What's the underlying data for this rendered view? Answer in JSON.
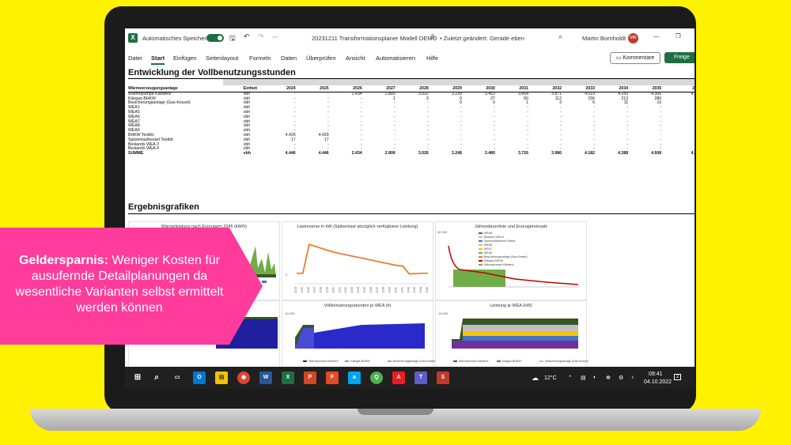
{
  "window": {
    "app_icon": "excel-icon",
    "autosave_label": "Automatisches Speichern",
    "filename": "20231211 Transformationsplaner Modell DEMO",
    "saved_status": "• Zuletzt geändert: Gerade eben",
    "user_name": "Martin Bornholdt",
    "user_initials": "MB"
  },
  "menu": [
    "Datei",
    "Start",
    "Einfügen",
    "Seitenlayout",
    "Formeln",
    "Daten",
    "Überprüfen",
    "Ansicht",
    "Automatisieren",
    "Hilfe"
  ],
  "menu_active": "Start",
  "comment_button": "Kommentare",
  "share_button": "Freige",
  "sheet": {
    "section1_title": "Entwicklung der Vollbenutzungsstunden",
    "section2_title": "Ergebnisgrafiken",
    "table": {
      "headers": [
        "Wärmeerzeugungsanlage",
        "Einheit",
        "2024",
        "2025",
        "2026",
        "2027",
        "2028",
        "2029",
        "2030",
        "2031",
        "2032",
        "2033",
        "2034",
        "2035",
        "2"
      ],
      "rows": [
        [
          "Wärmepumpe Klärwerk",
          "vbh",
          "-",
          "-",
          "2.434",
          "2.805",
          "3.022",
          "3.239",
          "3.453",
          "3.664",
          "3.871",
          "4.019",
          "4.165",
          "4.306",
          "4."
        ],
        [
          "Klärgas-BHKW",
          "vbh",
          "-",
          "-",
          "-",
          "1",
          "3",
          "9",
          "27",
          "60",
          "112",
          "156",
          "213",
          "286",
          ""
        ],
        [
          "Besicherungsanlage (Gas-Kessel)",
          "vbh",
          "-",
          "-",
          "-",
          "-",
          "-",
          "0",
          "0",
          "1",
          "3",
          "6",
          "11",
          "16",
          ""
        ],
        [
          "WEA1",
          "vbh",
          "-",
          "-",
          "-",
          "-",
          "-",
          "-",
          "-",
          "-",
          "-",
          "-",
          "-",
          "-",
          ""
        ],
        [
          "WEA5",
          "vbh",
          "-",
          "-",
          "-",
          "-",
          "-",
          "-",
          "-",
          "-",
          "-",
          "-",
          "-",
          "-",
          ""
        ],
        [
          "WEA6",
          "vbh",
          "-",
          "-",
          "-",
          "-",
          "-",
          "-",
          "-",
          "-",
          "-",
          "-",
          "-",
          "-",
          ""
        ],
        [
          "WEA7",
          "vbh",
          "-",
          "-",
          "-",
          "-",
          "-",
          "-",
          "-",
          "-",
          "-",
          "-",
          "-",
          "-",
          ""
        ],
        [
          "WEA8",
          "vbh",
          "-",
          "-",
          "-",
          "-",
          "-",
          "-",
          "-",
          "-",
          "-",
          "-",
          "-",
          "-",
          ""
        ],
        [
          "WEA9",
          "vbh",
          "-",
          "-",
          "-",
          "-",
          "-",
          "-",
          "-",
          "-",
          "-",
          "-",
          "-",
          "-",
          ""
        ],
        [
          "BHKW Testbtr.",
          "vbh",
          "4.429",
          "4.429",
          "-",
          "-",
          "-",
          "-",
          "-",
          "-",
          "-",
          "-",
          "-",
          "-",
          ""
        ],
        [
          "Spitzenlastkessel Testbtr.",
          "vbh",
          "17",
          "17",
          "-",
          "-",
          "-",
          "-",
          "-",
          "-",
          "-",
          "-",
          "-",
          "-",
          ""
        ],
        [
          "Bestands WEA 3",
          "vbh",
          "-",
          "-",
          "-",
          "-",
          "-",
          "-",
          "-",
          "-",
          "-",
          "-",
          "-",
          "-",
          ""
        ],
        [
          "Bestands WEA 4",
          "vbh",
          "-",
          "-",
          "-",
          "-",
          "-",
          "-",
          "-",
          "-",
          "-",
          "-",
          "-",
          "-",
          ""
        ]
      ],
      "sum_row": [
        "SUMME",
        "vbh",
        "4.446",
        "4.446",
        "2.434",
        "2.806",
        "3.026",
        "3.248",
        "3.480",
        "3.726",
        "3.986",
        "4.182",
        "4.388",
        "4.608",
        "4."
      ]
    },
    "charts": {
      "c1": {
        "title": "Wärmeleistung nach Erzeugern 2045 (kW/h)",
        "ytick": "1.200"
      },
      "c2": {
        "title": "Lastreserve in kW (Spitzenlast abzüglich verfügbarer Leistung)",
        "ytick": "0",
        "x": [
          "2024",
          "2025",
          "2026",
          "2027",
          "2028",
          "2029",
          "2030",
          "2031",
          "2032",
          "2033",
          "2034",
          "2035",
          "2036",
          "2037",
          "2038",
          "2039",
          "2040",
          "2041",
          "2042",
          "2043",
          "2044",
          "2045"
        ],
        "values": [
          1600,
          1600,
          6000,
          5700,
          5400,
          5100,
          4800,
          4600,
          4400,
          4200,
          4000,
          3800,
          3600,
          3400,
          3200,
          3000,
          2800,
          2700,
          1500,
          1550,
          1600,
          1600
        ]
      },
      "c3": {
        "title": "Jahresdauerlinie und Erzeugereinsatz",
        "ytick": "40.000",
        "legend": [
          "WEA8",
          "Bestand WEA 4",
          "Spitzenlastkessel Testbtr.",
          "WEA8",
          "WEA7",
          "WEA5",
          "Besicherungsanlage (Gas-Kessel)",
          "Klärgas-BHKW",
          "Wärmepumpe Klärwerk"
        ],
        "colors": [
          "#7f6000",
          "#bfbfbf",
          "#4472c4",
          "#a9d18e",
          "#ffc000",
          "#70ad47",
          "#ed7d31",
          "#c00000",
          "#70ad47"
        ]
      },
      "c5": {
        "title": "Vollbenutzungsstunden je WEA (h)",
        "ytick": "10.000",
        "legend": [
          "Wärmepumpe Klärwerk",
          "Klärgas-BHKW",
          "Besicherungsanlage (Gas-Kessel)",
          "WEA4",
          "WEA5",
          "WEA6",
          "WEA7",
          "WEA8"
        ]
      },
      "c6": {
        "title": "Leistung je WEA (kW)",
        "ytick": "10.000",
        "legend": [
          "Wärmepumpe Klärwerk",
          "Klärgas-BHKW",
          "Besicherungsanlage (Gas-Kessel)",
          "WEA4",
          "WEA5",
          "WEA6"
        ]
      }
    }
  },
  "callout": {
    "bold": "Geldersparnis:",
    "text": " Weniger Kosten für ausufernde Detailplanungen da wesentliche Varianten selbst ermittelt werden können"
  },
  "taskbar": {
    "temperature": "12°C",
    "time": "09:41",
    "date": "04.10.2022",
    "notifications": "2"
  }
}
